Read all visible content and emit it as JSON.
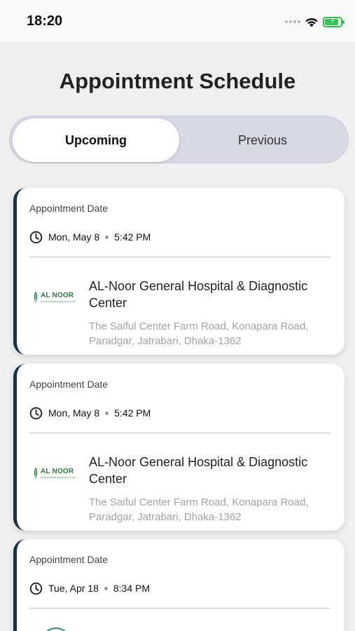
{
  "status_bar": {
    "time": "18:20"
  },
  "header": {
    "title": "Appointment Schedule"
  },
  "tabs": [
    {
      "label": "Upcoming",
      "active": true
    },
    {
      "label": "Previous",
      "active": false
    }
  ],
  "appointments": [
    {
      "label": "Appointment Date",
      "date": "Mon, May 8",
      "time": "5:42 PM",
      "hospital_name": "AL-Noor General Hospital & Diagnostic Center",
      "address": "The Saiful Center Farm Road, Konapara Road, Paradgar, Jatrabari, Dhaka-1362",
      "logo_text": "AL NOOR",
      "logo_tagline": "General Hospital & Diagnostic Center"
    },
    {
      "label": "Appointment Date",
      "date": "Mon, May 8",
      "time": "5:42 PM",
      "hospital_name": "AL-Noor General Hospital & Diagnostic Center",
      "address": "The Saiful Center Farm Road, Konapara Road, Paradgar, Jatrabari, Dhaka-1362",
      "logo_text": "AL NOOR",
      "logo_tagline": "General Hospital & Diagnostic Center"
    },
    {
      "label": "Appointment Date",
      "date": "Tue, Apr 18",
      "time": "8:34 PM"
    }
  ],
  "colors": {
    "card_accent": "#153344",
    "logo_green": "#2a7a3c",
    "segment_bg": "#d6d8e3",
    "battery_green": "#36c552"
  }
}
